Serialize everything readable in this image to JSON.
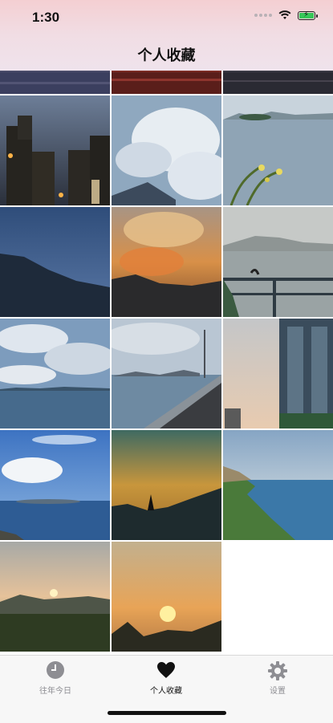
{
  "status_bar": {
    "time": "1:30"
  },
  "header": {
    "title": "个人收藏"
  },
  "photos": [
    {
      "name": "photo-sea-dusk-top-1"
    },
    {
      "name": "photo-sea-dusk-top-2"
    },
    {
      "name": "photo-sea-dusk-top-3"
    },
    {
      "name": "photo-night-buildings"
    },
    {
      "name": "photo-clouds-sky"
    },
    {
      "name": "photo-sea-flowers"
    },
    {
      "name": "photo-blue-hills"
    },
    {
      "name": "photo-orange-sunset-clouds"
    },
    {
      "name": "photo-bay-railing"
    },
    {
      "name": "photo-sea-clouds"
    },
    {
      "name": "photo-waterfront-road"
    },
    {
      "name": "photo-tower-building"
    },
    {
      "name": "photo-blue-sky-sea"
    },
    {
      "name": "photo-golden-hill-pylon"
    },
    {
      "name": "photo-cliff-sea"
    },
    {
      "name": "photo-sunset-hills"
    },
    {
      "name": "photo-sunset-trees"
    }
  ],
  "tabs": [
    {
      "label": "往年今日",
      "icon": "clock-icon",
      "active": false
    },
    {
      "label": "个人收藏",
      "icon": "heart-icon",
      "active": true
    },
    {
      "label": "设置",
      "icon": "gear-icon",
      "active": false
    }
  ],
  "colors": {
    "tab_active": "#111111",
    "tab_inactive": "#8e8e93"
  }
}
